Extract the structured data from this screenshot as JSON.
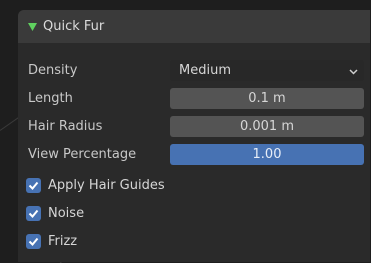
{
  "panel": {
    "title": "Quick Fur",
    "expand_icon": "triangle-down-icon"
  },
  "properties": {
    "density": {
      "label": "Density",
      "value": "Medium"
    },
    "length": {
      "label": "Length",
      "value": "0.1 m"
    },
    "hair_radius": {
      "label": "Hair Radius",
      "value": "0.001 m"
    },
    "view_percentage": {
      "label": "View Percentage",
      "value": "1.00",
      "fraction": 1.0
    }
  },
  "checkboxes": {
    "apply_hair_guides": {
      "label": "Apply Hair Guides",
      "checked": true
    },
    "noise": {
      "label": "Noise",
      "checked": true
    },
    "frizz": {
      "label": "Frizz",
      "checked": true
    }
  },
  "colors": {
    "accent": "#4772b3",
    "panel_bg": "#2a2a2a",
    "header_bg": "#3a3a3a",
    "field_bg": "#545454",
    "dropdown_bg": "#282828"
  }
}
